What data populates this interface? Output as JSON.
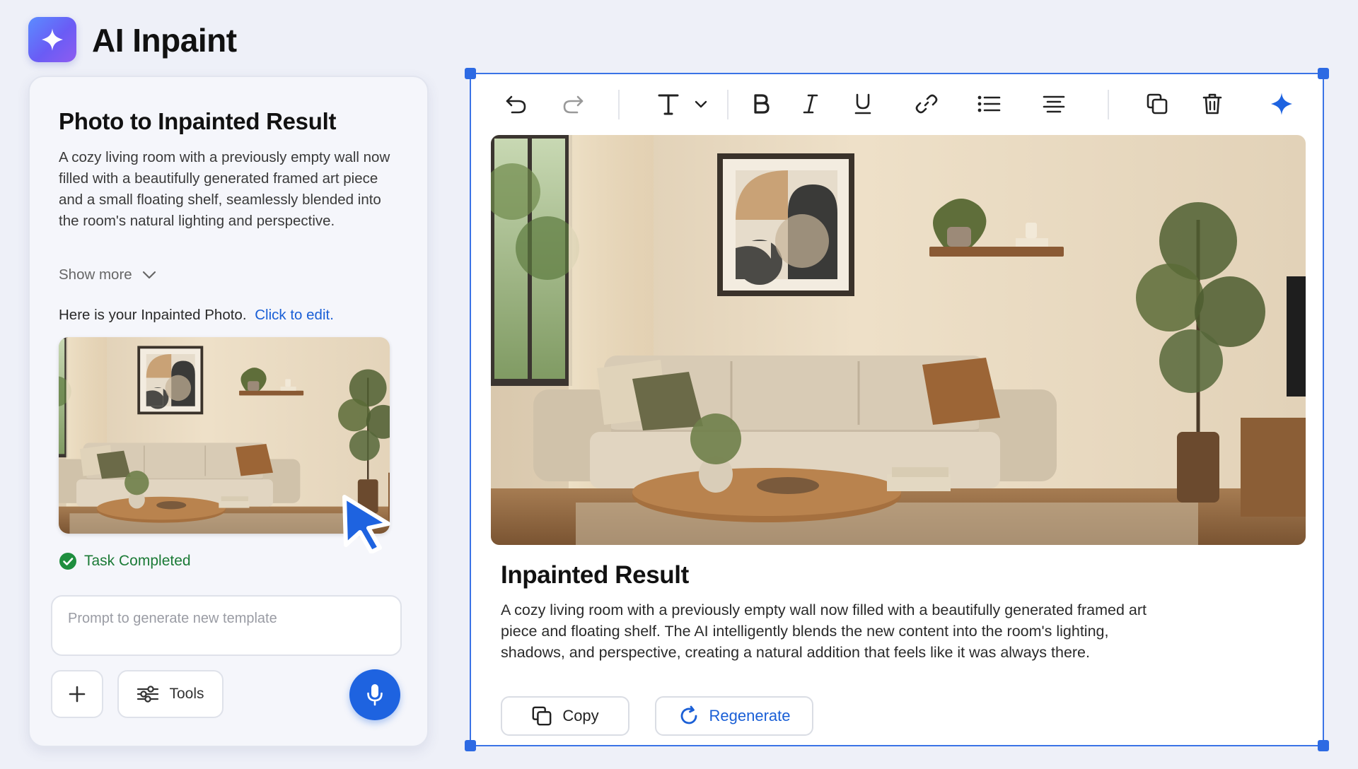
{
  "app": {
    "title": "AI Inpaint",
    "accent_color": "#1e63e0",
    "logo_icon": "sparkle-icon"
  },
  "left_panel": {
    "title": "Photo to Inpainted Result",
    "description": "A cozy living room with a previously empty wall now filled with a beautifully generated framed art piece and a small floating shelf, seamlessly blended into the room's natural lighting and perspective.",
    "show_more_label": "Show more",
    "result_message": "Here is your Inpainted Photo.",
    "edit_link_label": "Click to edit.",
    "status_label": "Task Completed",
    "status_color": "#1b7a36",
    "prompt_placeholder": "Prompt to generate new template",
    "prompt_value": "",
    "tools_label": "Tools"
  },
  "toolbar": {
    "items": [
      "undo-icon",
      "redo-icon",
      "text-style-icon",
      "bold-icon",
      "italic-icon",
      "underline-icon",
      "link-icon",
      "bullet-list-icon",
      "align-icon",
      "duplicate-icon",
      "delete-icon",
      "ai-sparkle-icon"
    ]
  },
  "editor": {
    "result_title": "Inpainted Result",
    "result_description": "A cozy living room with a previously empty wall now filled with a beautifully generated framed art piece and floating shelf. The AI intelligently blends the new content into the room's lighting, shadows, and perspective, creating a natural addition that feels like it was always there.",
    "copy_label": "Copy",
    "regenerate_label": "Regenerate"
  }
}
